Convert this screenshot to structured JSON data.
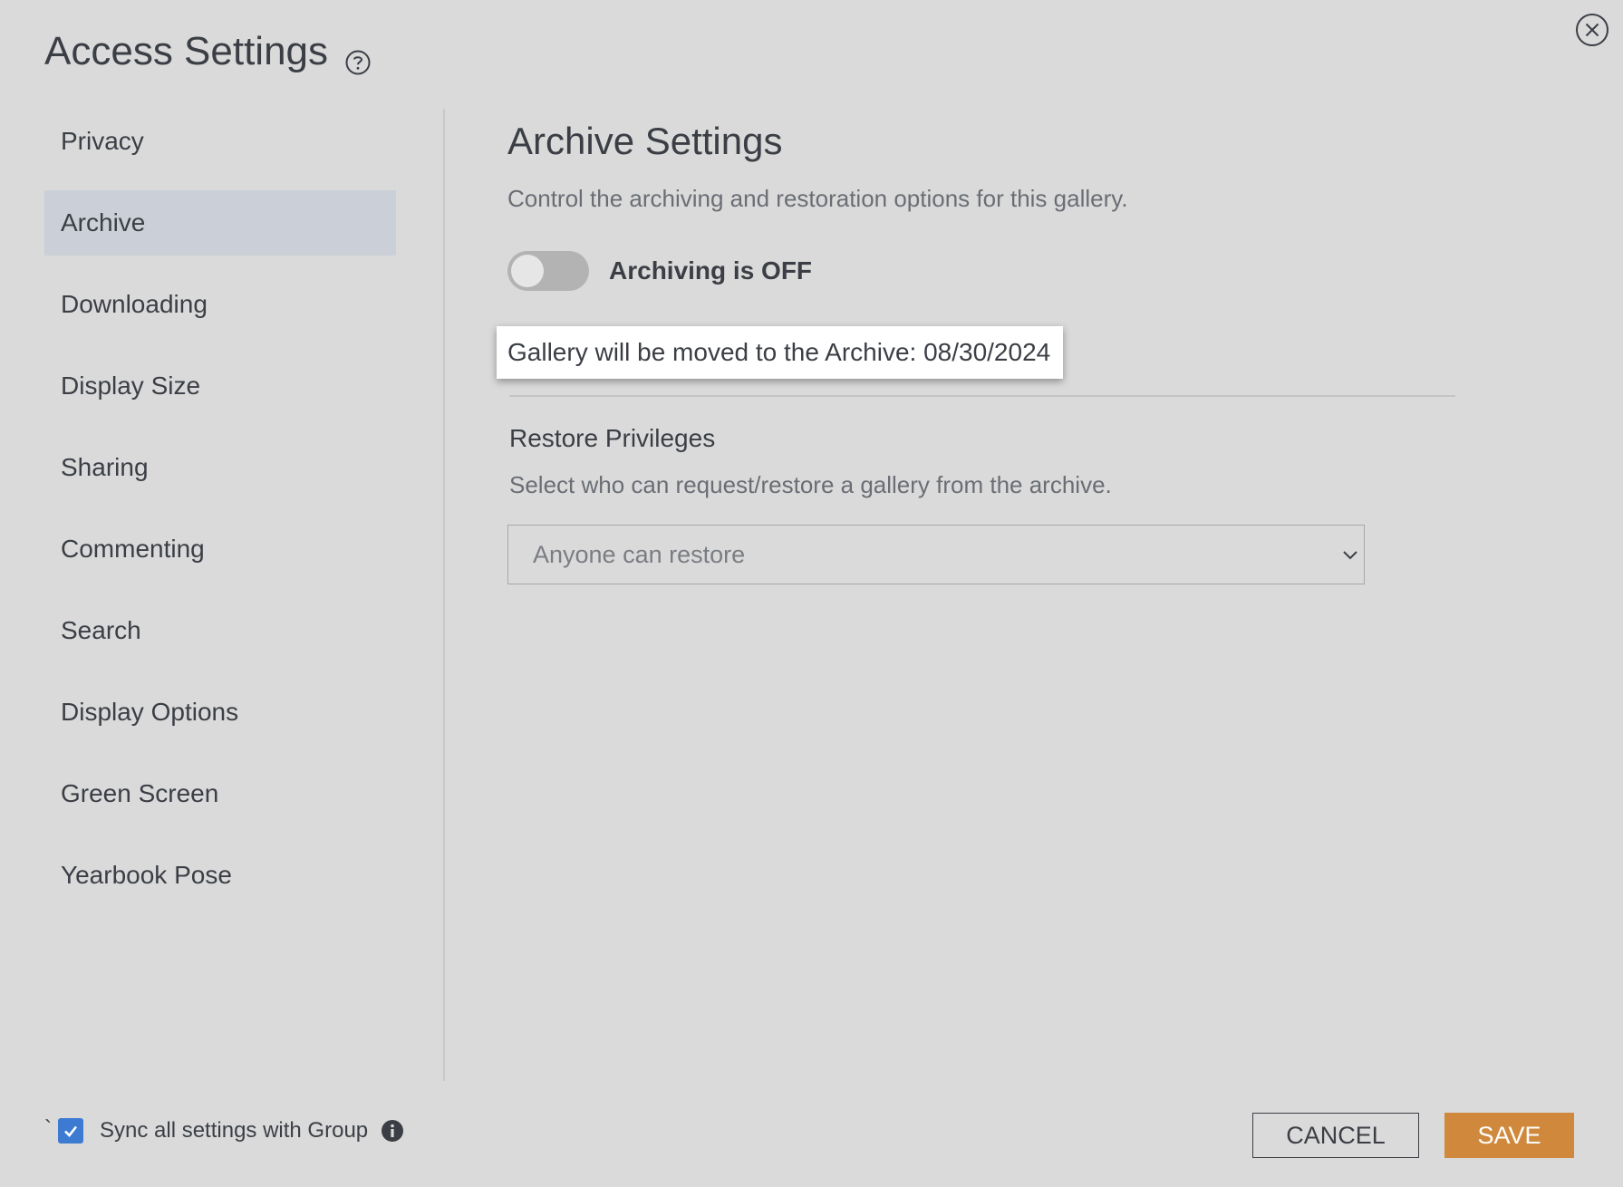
{
  "dialog": {
    "title": "Access Settings",
    "help_icon": "question-circle-icon",
    "close_icon": "close-circle-icon"
  },
  "sidebar": {
    "active_index": 1,
    "items": [
      {
        "label": "Privacy"
      },
      {
        "label": "Archive"
      },
      {
        "label": "Downloading"
      },
      {
        "label": "Display Size"
      },
      {
        "label": "Sharing"
      },
      {
        "label": "Commenting"
      },
      {
        "label": "Search"
      },
      {
        "label": "Display Options"
      },
      {
        "label": "Green Screen"
      },
      {
        "label": "Yearbook Pose"
      }
    ]
  },
  "archive": {
    "title": "Archive Settings",
    "description": "Control the archiving and restoration options for this gallery.",
    "toggle_state": "off",
    "toggle_label": "Archiving is OFF",
    "tooltip": "Gallery will be moved to the Archive: 08/30/2024"
  },
  "restore": {
    "title": "Restore Privileges",
    "description": "Select who can request/restore a gallery from the archive.",
    "selected_option": "Anyone can restore"
  },
  "footer": {
    "tick_char": "`",
    "sync_checked": true,
    "sync_label": "Sync all settings with Group",
    "info_icon": "info-circle-icon",
    "cancel_label": "CANCEL",
    "save_label": "SAVE"
  },
  "colors": {
    "background": "#dadada",
    "active_item": "#cbcfd7",
    "save_button": "#d0893c",
    "checkbox": "#3d7bd2",
    "text": "#3b3f45"
  }
}
